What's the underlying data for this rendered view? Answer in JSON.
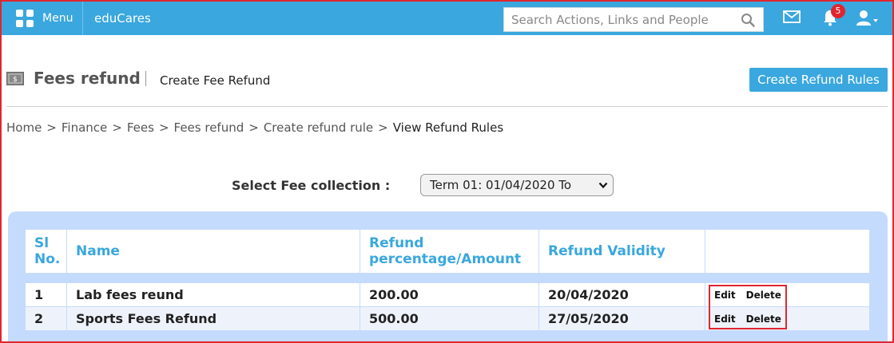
{
  "header": {
    "menu_label": "Menu",
    "brand": "eduCares",
    "search_placeholder": "Search Actions, Links and People",
    "notification_count": "5",
    "icons": [
      "grid-icon",
      "search-icon",
      "mail-icon",
      "bell-icon",
      "user-icon"
    ]
  },
  "page": {
    "title": "Fees refund",
    "subtitle": "Create Fee Refund",
    "create_button": "Create Refund Rules"
  },
  "breadcrumb": [
    "Home",
    "Finance",
    "Fees",
    "Fees refund",
    "Create refund rule",
    "View Refund Rules"
  ],
  "breadcrumb_separator": ">",
  "filter": {
    "label": "Select Fee collection :",
    "selected": "Term 01: 01/04/2020 To"
  },
  "table": {
    "headers": [
      "Sl No.",
      "Name",
      "Refund percentage/Amount",
      "Refund Validity",
      ""
    ],
    "rows": [
      {
        "sl": "1",
        "name": "Lab fees reund",
        "amount": "200.00",
        "validity": "20/04/2020",
        "edit": "Edit",
        "delete": "Delete"
      },
      {
        "sl": "2",
        "name": "Sports Fees Refund",
        "amount": "500.00",
        "validity": "27/05/2020",
        "edit": "Edit",
        "delete": "Delete"
      }
    ]
  },
  "colors": {
    "accent": "#3aa7de",
    "panel": "#c5dbfd",
    "highlight": "#e0262f"
  }
}
